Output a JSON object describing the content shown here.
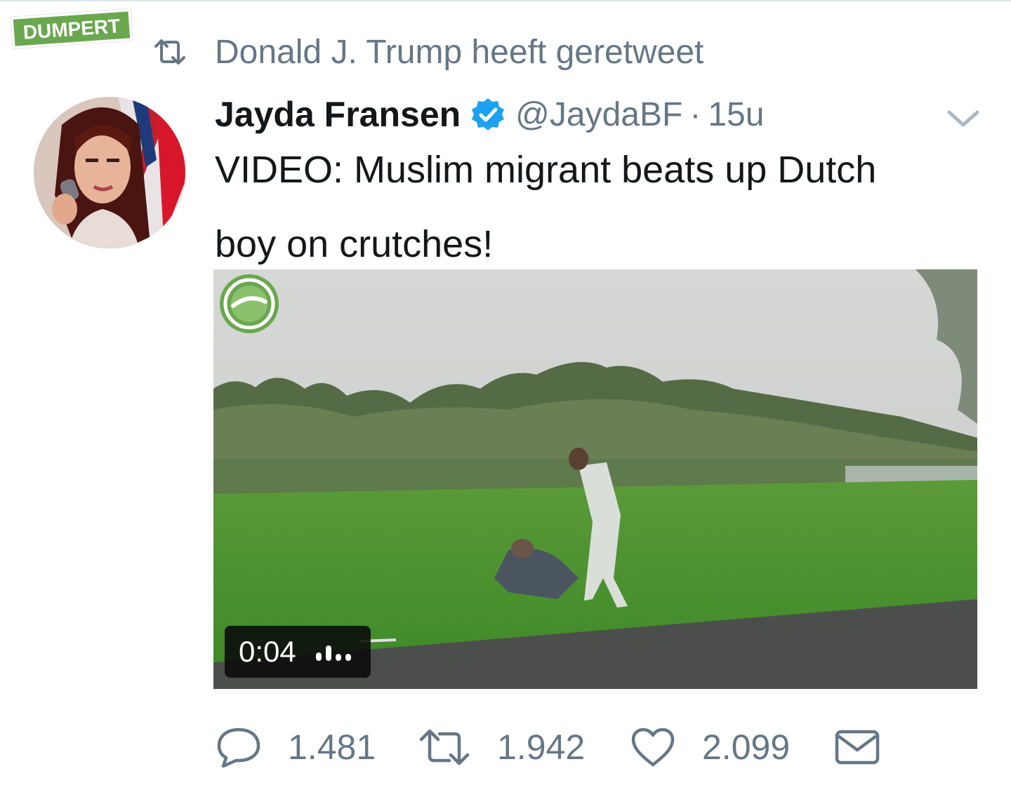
{
  "watermark": {
    "label": "DUMPERT"
  },
  "retweet_context": {
    "icon": "retweet-icon",
    "text": "Donald J. Trump heeft geretweet"
  },
  "tweet": {
    "author_name": "Jayda Fransen",
    "verified_icon": "verified-badge-icon",
    "handle": "@JaydaBF",
    "separator": "·",
    "time": "15u",
    "menu_icon": "chevron-down-icon",
    "text_lines": [
      "VIDEO: Muslim migrant beats up Dutch",
      "boy on crutches!"
    ],
    "video": {
      "duration": "0:04",
      "audio_icon": "audio-bars-icon",
      "logo_icon": "dumpert-logo-icon"
    },
    "actions": {
      "reply": {
        "icon": "reply-icon",
        "count": "1.481"
      },
      "retweet": {
        "icon": "retweet-icon",
        "count": "1.942"
      },
      "like": {
        "icon": "heart-icon",
        "count": "2.099"
      },
      "dm": {
        "icon": "envelope-icon"
      }
    }
  },
  "colors": {
    "text_primary": "#14171a",
    "text_secondary": "#657786",
    "verified_blue": "#1da1f2",
    "dumpert_green": "#6aa84f"
  }
}
